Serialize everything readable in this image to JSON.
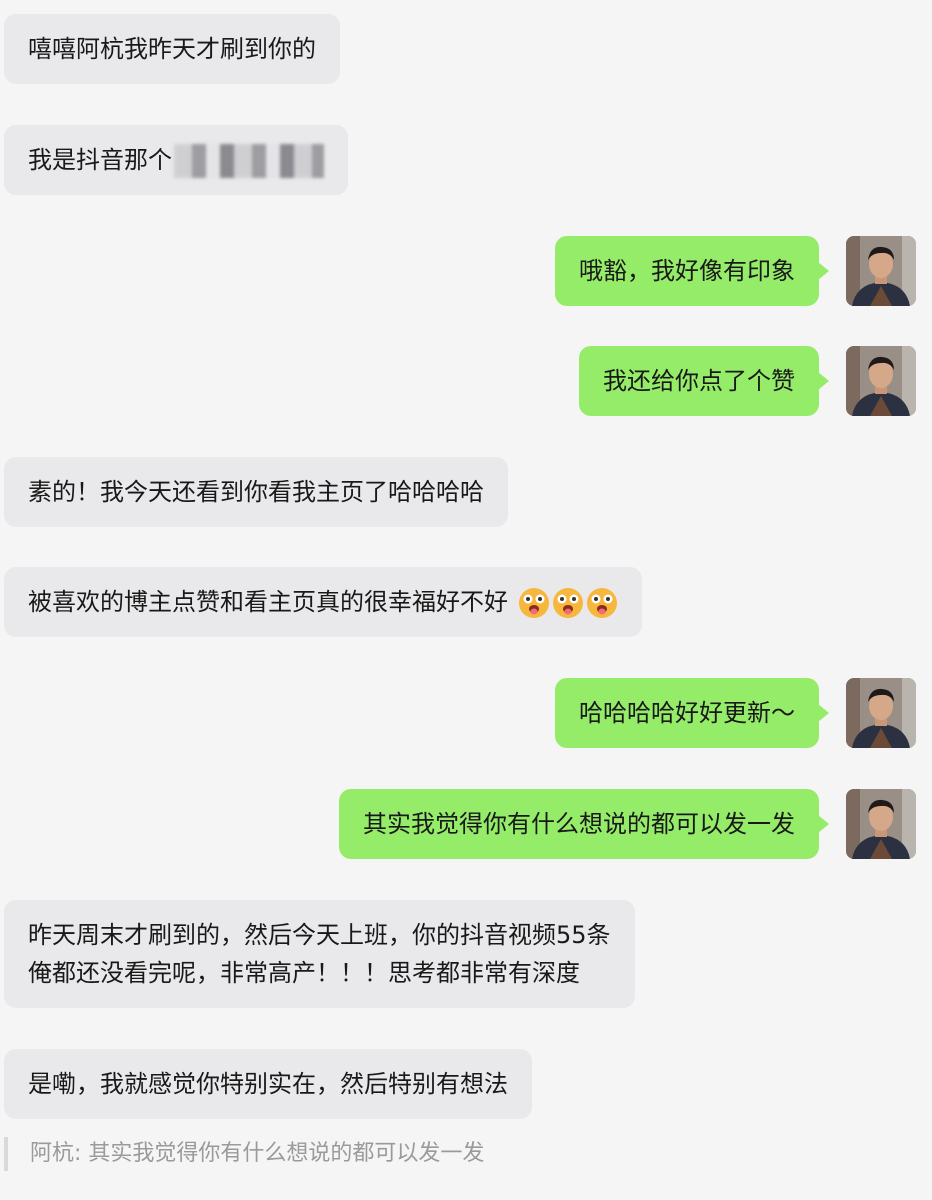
{
  "messages": [
    {
      "side": "left",
      "text": "嘻嘻阿杭我昨天才刷到你的"
    },
    {
      "side": "left",
      "text": "我是抖音那个"
    },
    {
      "side": "right",
      "text": "哦豁，我好像有印象"
    },
    {
      "side": "right",
      "text": "我还给你点了个赞"
    },
    {
      "side": "left",
      "text": "素的！我今天还看到你看我主页了哈哈哈哈"
    },
    {
      "side": "left",
      "text": "被喜欢的博主点赞和看主页真的很幸福好不好"
    },
    {
      "side": "right",
      "text": "哈哈哈哈好好更新～"
    },
    {
      "side": "right",
      "text": "其实我觉得你有什么想说的都可以发一发"
    },
    {
      "side": "left",
      "line1": "昨天周末才刷到的，然后今天上班，你的抖音视频55条",
      "line2": "俺都还没看完呢，非常高产！！！思考都非常有深度"
    },
    {
      "side": "left",
      "text": "是嘞，我就感觉你特别实在，然后特别有想法"
    }
  ],
  "quote": {
    "text": "阿杭: 其实我觉得你有什么想说的都可以发一发"
  },
  "icons": {
    "avatar": "user-avatar-photo",
    "emoji": "tongue-out-emoji",
    "redaction": "blurred-username"
  },
  "colors": {
    "background": "#f5f5f5",
    "left_bubble": "#e9e9eb",
    "right_bubble": "#95ec69"
  }
}
